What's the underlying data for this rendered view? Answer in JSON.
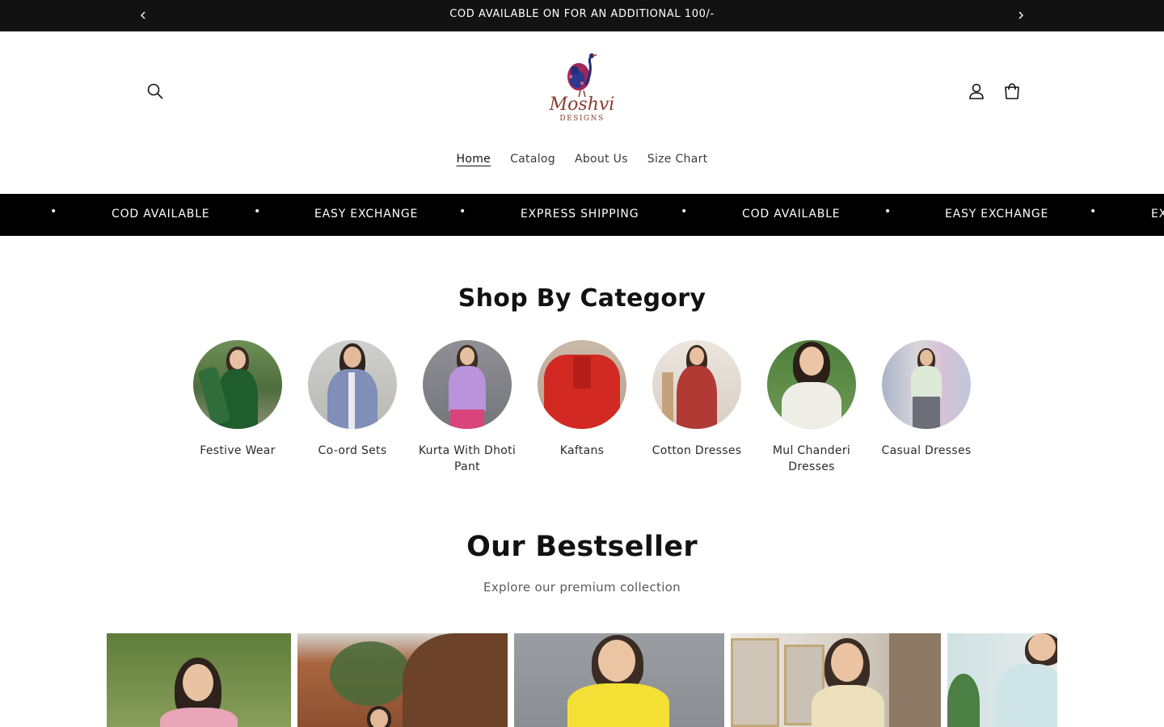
{
  "announcement": {
    "text": "COD AVAILABLE ON FOR AN ADDITIONAL 100/-",
    "prev_icon": "chevron-left-icon",
    "next_icon": "chevron-right-icon"
  },
  "header": {
    "logo_name": "Moshvi",
    "logo_sub": "DESIGNS",
    "icons": [
      "search-icon",
      "account-icon",
      "cart-icon"
    ],
    "nav": [
      {
        "label": "Home",
        "active": true
      },
      {
        "label": "Catalog",
        "active": false
      },
      {
        "label": "About Us",
        "active": false
      },
      {
        "label": "Size Chart",
        "active": false
      }
    ]
  },
  "marquee": {
    "separator": "•",
    "items": [
      "COD AVAILABLE",
      "EASY EXCHANGE",
      "EXPRESS SHIPPING",
      "COD AVAILABLE",
      "EASY EXCHANGE",
      "EX"
    ]
  },
  "categories": {
    "title": "Shop By Category",
    "items": [
      {
        "label": "Festive Wear"
      },
      {
        "label": "Co-ord Sets"
      },
      {
        "label": "Kurta With Dhoti Pant"
      },
      {
        "label": "Kaftans"
      },
      {
        "label": "Cotton Dresses"
      },
      {
        "label": "Mul Chanderi Dresses"
      },
      {
        "label": "Casual Dresses"
      }
    ]
  },
  "bestseller": {
    "title": "Our Bestseller",
    "subtitle": "Explore our premium collection"
  },
  "colors": {
    "bar_bg": "#121212",
    "marquee_bg": "#000000",
    "brand": "#8a3d2e"
  }
}
